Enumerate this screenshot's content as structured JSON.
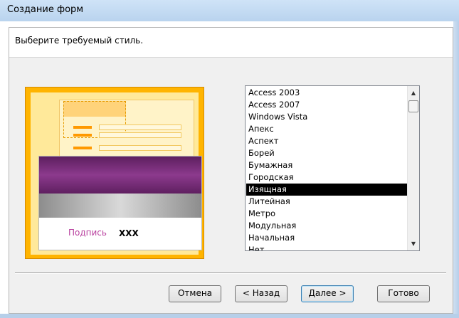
{
  "window": {
    "title": "Создание форм"
  },
  "prompt": "Выберите требуемый стиль.",
  "preview": {
    "caption_label": "Подпись",
    "caption_value": "XXX"
  },
  "styles": {
    "selected": "Изящная",
    "items": [
      "Access 2003",
      "Access 2007",
      "Windows Vista",
      "Апекс",
      "Аспект",
      "Борей",
      "Бумажная",
      "Городская",
      "Изящная",
      "Литейная",
      "Метро",
      "Модульная",
      "Начальная",
      "Нет"
    ]
  },
  "scroll_icons": {
    "up": "arrow-up-icon",
    "down": "arrow-down-icon",
    "up_glyph": "▲",
    "down_glyph": "▼"
  },
  "buttons": {
    "cancel": "Отмена",
    "back": "< Назад",
    "next": "Далее >",
    "finish": "Готово"
  },
  "colors": {
    "selection": "#000000",
    "preview_accent": "#ffb400",
    "caption_color": "#b83f9e"
  }
}
